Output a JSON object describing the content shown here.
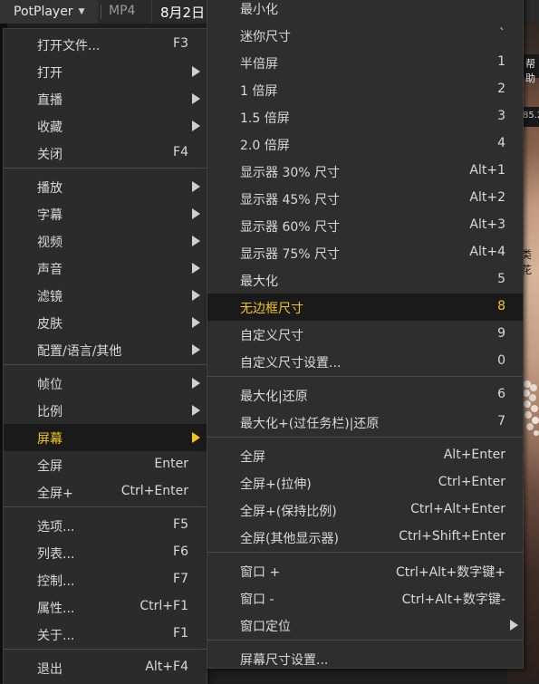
{
  "topbar": {
    "app_title": "PotPlayer",
    "format": "MP4",
    "date": "8月2日"
  },
  "background": {
    "label_1": "帮助",
    "label_2": "85.2",
    "label_3": "类花"
  },
  "main_menu": {
    "items": [
      {
        "label": "打开文件...",
        "shortcut": "F3",
        "submenu": false
      },
      {
        "label": "打开",
        "shortcut": "",
        "submenu": true
      },
      {
        "label": "直播",
        "shortcut": "",
        "submenu": true
      },
      {
        "label": "收藏",
        "shortcut": "",
        "submenu": true
      },
      {
        "label": "关闭",
        "shortcut": "F4",
        "submenu": false
      },
      {
        "label": "播放",
        "shortcut": "",
        "submenu": true
      },
      {
        "label": "字幕",
        "shortcut": "",
        "submenu": true
      },
      {
        "label": "视频",
        "shortcut": "",
        "submenu": true
      },
      {
        "label": "声音",
        "shortcut": "",
        "submenu": true
      },
      {
        "label": "滤镜",
        "shortcut": "",
        "submenu": true
      },
      {
        "label": "皮肤",
        "shortcut": "",
        "submenu": true
      },
      {
        "label": "配置/语言/其他",
        "shortcut": "",
        "submenu": true
      },
      {
        "label": "帧位",
        "shortcut": "",
        "submenu": true
      },
      {
        "label": "比例",
        "shortcut": "",
        "submenu": true
      },
      {
        "label": "屏幕",
        "shortcut": "",
        "submenu": true,
        "active": true
      },
      {
        "label": "全屏",
        "shortcut": "Enter",
        "submenu": false
      },
      {
        "label": "全屏+",
        "shortcut": "Ctrl+Enter",
        "submenu": false
      },
      {
        "label": "选项...",
        "shortcut": "F5",
        "submenu": false
      },
      {
        "label": "列表...",
        "shortcut": "F6",
        "submenu": false
      },
      {
        "label": "控制...",
        "shortcut": "F7",
        "submenu": false
      },
      {
        "label": "属性...",
        "shortcut": "Ctrl+F1",
        "submenu": false
      },
      {
        "label": "关于...",
        "shortcut": "F1",
        "submenu": false
      },
      {
        "label": "退出",
        "shortcut": "Alt+F4",
        "submenu": false
      }
    ]
  },
  "screen_menu": {
    "items": [
      {
        "label": "最小化",
        "shortcut": "",
        "submenu": false
      },
      {
        "label": "迷你尺寸",
        "shortcut": "`",
        "submenu": false
      },
      {
        "label": "半倍屏",
        "shortcut": "1",
        "submenu": false
      },
      {
        "label": "1 倍屏",
        "shortcut": "2",
        "submenu": false
      },
      {
        "label": "1.5 倍屏",
        "shortcut": "3",
        "submenu": false
      },
      {
        "label": "2.0 倍屏",
        "shortcut": "4",
        "submenu": false
      },
      {
        "label": "显示器 30% 尺寸",
        "shortcut": "Alt+1",
        "submenu": false
      },
      {
        "label": "显示器 45% 尺寸",
        "shortcut": "Alt+2",
        "submenu": false
      },
      {
        "label": "显示器 60% 尺寸",
        "shortcut": "Alt+3",
        "submenu": false
      },
      {
        "label": "显示器 75% 尺寸",
        "shortcut": "Alt+4",
        "submenu": false
      },
      {
        "label": "最大化",
        "shortcut": "5",
        "submenu": false
      },
      {
        "label": "无边框尺寸",
        "shortcut": "8",
        "submenu": false,
        "active": true
      },
      {
        "label": "自定义尺寸",
        "shortcut": "9",
        "submenu": false
      },
      {
        "label": "自定义尺寸设置...",
        "shortcut": "0",
        "submenu": false
      },
      {
        "label": "最大化|还原",
        "shortcut": "6",
        "submenu": false
      },
      {
        "label": "最大化+(过任务栏)|还原",
        "shortcut": "7",
        "submenu": false
      },
      {
        "label": "全屏",
        "shortcut": "Alt+Enter",
        "submenu": false
      },
      {
        "label": "全屏+(拉伸)",
        "shortcut": "Ctrl+Enter",
        "submenu": false
      },
      {
        "label": "全屏+(保持比例)",
        "shortcut": "Ctrl+Alt+Enter",
        "submenu": false
      },
      {
        "label": "全屏(其他显示器)",
        "shortcut": "Ctrl+Shift+Enter",
        "submenu": false
      },
      {
        "label": "窗口 +",
        "shortcut": "Ctrl+Alt+数字键+",
        "submenu": false
      },
      {
        "label": "窗口 -",
        "shortcut": "Ctrl+Alt+数字键-",
        "submenu": false
      },
      {
        "label": "窗口定位",
        "shortcut": "",
        "submenu": true
      },
      {
        "label": "屏幕尺寸设置...",
        "shortcut": "",
        "submenu": false
      }
    ]
  },
  "colors": {
    "accent_highlight": "#f5c518",
    "menu_bg": "#2b2b2b",
    "text": "#d9d9d9"
  }
}
